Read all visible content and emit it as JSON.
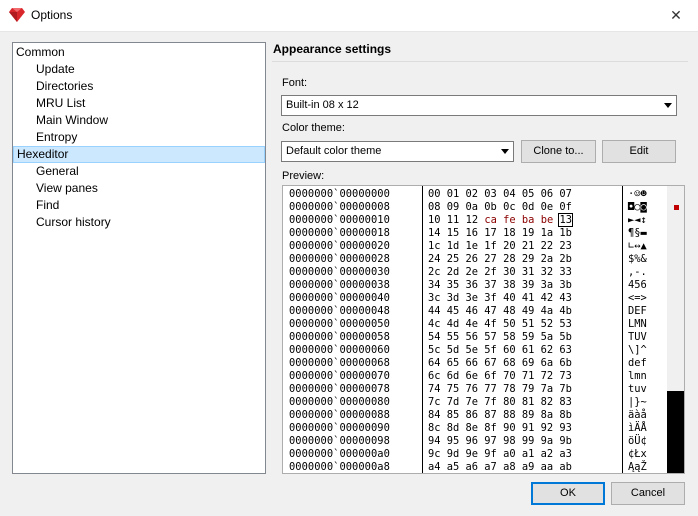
{
  "window": {
    "title": "Options",
    "close_glyph": "✕"
  },
  "tree": {
    "items": [
      {
        "label": "Common",
        "level": 0
      },
      {
        "label": "Update",
        "level": 1
      },
      {
        "label": "Directories",
        "level": 1
      },
      {
        "label": "MRU List",
        "level": 1
      },
      {
        "label": "Main Window",
        "level": 1
      },
      {
        "label": "Entropy",
        "level": 1
      },
      {
        "label": "Hexeditor",
        "level": 0,
        "selected": true
      },
      {
        "label": "General",
        "level": 1
      },
      {
        "label": "View panes",
        "level": 1
      },
      {
        "label": "Find",
        "level": 1
      },
      {
        "label": "Cursor history",
        "level": 1
      }
    ]
  },
  "settings": {
    "section_title": "Appearance settings",
    "font_label": "Font:",
    "font_value": "Built-in 08 x 12",
    "color_theme_label": "Color theme:",
    "color_theme_value": "Default color theme",
    "clone_button": "Clone to...",
    "edit_button": "Edit",
    "preview_label": "Preview:"
  },
  "preview": {
    "addresses": [
      "0000000`00000000",
      "0000000`00000008",
      "0000000`00000010",
      "0000000`00000018",
      "0000000`00000020",
      "0000000`00000028",
      "0000000`00000030",
      "0000000`00000038",
      "0000000`00000040",
      "0000000`00000048",
      "0000000`00000050",
      "0000000`00000058",
      "0000000`00000060",
      "0000000`00000068",
      "0000000`00000070",
      "0000000`00000078",
      "0000000`00000080",
      "0000000`00000088",
      "0000000`00000090",
      "0000000`00000098",
      "0000000`000000a0",
      "0000000`000000a8"
    ],
    "hex_rows": [
      "00 01 02 03 04 05 06 07",
      "08 09 0a 0b 0c 0d 0e 0f",
      "10 11 12 ca fe ba be 13",
      "14 15 16 17 18 19 1a 1b",
      "1c 1d 1e 1f 20 21 22 23",
      "24 25 26 27 28 29 2a 2b",
      "2c 2d 2e 2f 30 31 32 33",
      "34 35 36 37 38 39 3a 3b",
      "3c 3d 3e 3f 40 41 42 43",
      "44 45 46 47 48 49 4a 4b",
      "4c 4d 4e 4f 50 51 52 53",
      "54 55 56 57 58 59 5a 5b",
      "5c 5d 5e 5f 60 61 62 63",
      "64 65 66 67 68 69 6a 6b",
      "6c 6d 6e 6f 70 71 72 73",
      "74 75 76 77 78 79 7a 7b",
      "7c 7d 7e 7f 80 81 82 83",
      "84 85 86 87 88 89 8a 8b",
      "8c 8d 8e 8f 90 91 92 93",
      "94 95 96 97 98 99 9a 9b",
      "9c 9d 9e 9f a0 a1 a2 a3",
      "a4 a5 a6 a7 a8 a9 aa ab"
    ],
    "ascii_rows": [
      "·☺☻",
      "◘○◙",
      "►◄↕",
      "¶§▬",
      "∟↔▲",
      "$%&",
      "‚-.",
      "456",
      "<=>",
      "DEF",
      "LMN",
      "TUV",
      "\\]^",
      "def",
      "lmn",
      "tuv",
      "|}~",
      "äàå",
      "ìÄÅ",
      "öÜ¢",
      "¢Łx",
      "ĄąŽ"
    ]
  },
  "footer": {
    "ok_button": "OK",
    "cancel_button": "Cancel"
  },
  "colors": {
    "selection": "#cce8ff",
    "highlight_bytes": "#8b0000",
    "accent": "#0078d7"
  }
}
